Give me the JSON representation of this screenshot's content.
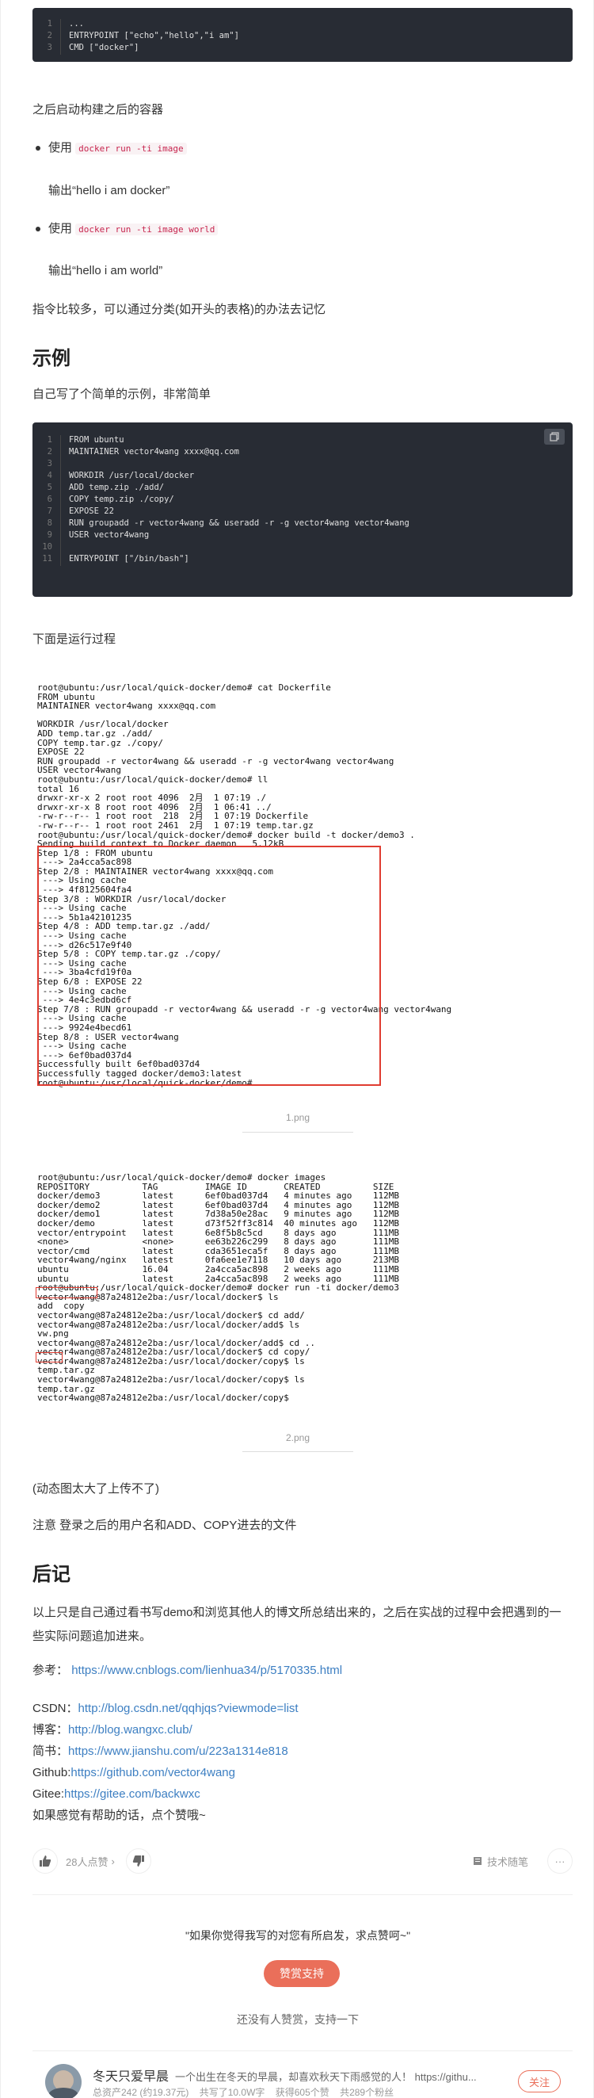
{
  "code_block_1": {
    "lines": [
      {
        "num": "1",
        "text": "..."
      },
      {
        "num": "2",
        "text": "ENTRYPOINT [\"echo\",\"hello\",\"i am\"]"
      },
      {
        "num": "3",
        "text": "CMD [\"docker\"]"
      }
    ]
  },
  "text_after_start": "之后启动构建之后的容器",
  "bullets": [
    {
      "prefix": "使用 ",
      "code": "docker run -ti image",
      "output": "输出“hello i am docker”"
    },
    {
      "prefix": "使用 ",
      "code": "docker run -ti image world",
      "output": "输出“hello i am world”"
    }
  ],
  "text_commands_many": "指令比较多，可以通过分类(如开头的表格)的办法去记忆",
  "heading_example": "示例",
  "text_example_intro": "自己写了个简单的示例，非常简单",
  "code_block_2": {
    "lines": [
      {
        "num": "1",
        "text": "FROM ubuntu"
      },
      {
        "num": "2",
        "text": "MAINTAINER vector4wang xxxx@qq.com"
      },
      {
        "num": "3",
        "text": ""
      },
      {
        "num": "4",
        "text": "WORKDIR /usr/local/docker"
      },
      {
        "num": "5",
        "text": "ADD temp.zip ./add/"
      },
      {
        "num": "6",
        "text": "COPY temp.zip ./copy/"
      },
      {
        "num": "7",
        "text": "EXPOSE 22"
      },
      {
        "num": "8",
        "text": "RUN groupadd -r vector4wang && useradd -r -g vector4wang vector4wang"
      },
      {
        "num": "9",
        "text": "USER vector4wang"
      },
      {
        "num": "10",
        "text": ""
      },
      {
        "num": "11",
        "text": "ENTRYPOINT [\"/bin/bash\"]"
      }
    ]
  },
  "text_run_process": "下面是运行过程",
  "terminal_1": [
    "root@ubuntu:/usr/local/quick-docker/demo# cat Dockerfile",
    "FROM ubuntu",
    "MAINTAINER vector4wang xxxx@qq.com",
    "",
    "WORKDIR /usr/local/docker",
    "ADD temp.tar.gz ./add/",
    "COPY temp.tar.gz ./copy/",
    "EXPOSE 22",
    "RUN groupadd -r vector4wang && useradd -r -g vector4wang vector4wang",
    "USER vector4wang",
    "root@ubuntu:/usr/local/quick-docker/demo# ll",
    "total 16",
    "drwxr-xr-x 2 root root 4096  2月  1 07:19 ./",
    "drwxr-xr-x 8 root root 4096  2月  1 06:41 ../",
    "-rw-r--r-- 1 root root  218  2月  1 07:19 Dockerfile",
    "-rw-r--r-- 1 root root 2461  2月  1 07:19 temp.tar.gz",
    "root@ubuntu:/usr/local/quick-docker/demo# docker build -t docker/demo3 .",
    "Sending build context to Docker daemon   5.12kB",
    "Step 1/8 : FROM ubuntu",
    " ---> 2a4cca5ac898",
    "Step 2/8 : MAINTAINER vector4wang xxxx@qq.com",
    " ---> Using cache",
    " ---> 4f8125604fa4",
    "Step 3/8 : WORKDIR /usr/local/docker",
    " ---> Using cache",
    " ---> 5b1a42101235",
    "Step 4/8 : ADD temp.tar.gz ./add/",
    " ---> Using cache",
    " ---> d26c517e9f40",
    "Step 5/8 : COPY temp.tar.gz ./copy/",
    " ---> Using cache",
    " ---> 3ba4cfd19f0a",
    "Step 6/8 : EXPOSE 22",
    " ---> Using cache",
    " ---> 4e4c3edbd6cf",
    "Step 7/8 : RUN groupadd -r vector4wang && useradd -r -g vector4wang vector4wang",
    " ---> Using cache",
    " ---> 9924e4becd61",
    "Step 8/8 : USER vector4wang",
    " ---> Using cache",
    " ---> 6ef0bad037d4",
    "Successfully built 6ef0bad037d4",
    "Successfully tagged docker/demo3:latest",
    "root@ubuntu:/usr/local/quick-docker/demo#"
  ],
  "caption_1": "1.png",
  "terminal_2": [
    "root@ubuntu:/usr/local/quick-docker/demo# docker images",
    "REPOSITORY          TAG         IMAGE ID       CREATED          SIZE",
    "docker/demo3        latest      6ef0bad037d4   4 minutes ago    112MB",
    "docker/demo2        latest      6ef0bad037d4   4 minutes ago    112MB",
    "docker/demo1        latest      7d38a50e28ac   9 minutes ago    112MB",
    "docker/demo         latest      d73f52ff3c814  40 minutes ago   112MB",
    "vector/entrypoint   latest      6e8f5b8c5cd    8 days ago       111MB",
    "<none>              <none>      ee63b226c299   8 days ago       111MB",
    "vector/cmd          latest      cda3651eca5f   8 days ago       111MB",
    "vector4wang/nginx   latest      0fa6ee1e7118   10 days ago      213MB",
    "ubuntu              16.04       2a4cca5ac898   2 weeks ago      111MB",
    "ubuntu              latest      2a4cca5ac898   2 weeks ago      111MB",
    "root@ubuntu:/usr/local/quick-docker/demo# docker run -ti docker/demo3",
    "vector4wang@87a24812e2ba:/usr/local/docker$ ls",
    "add  copy",
    "vector4wang@87a24812e2ba:/usr/local/docker$ cd add/",
    "vector4wang@87a24812e2ba:/usr/local/docker/add$ ls",
    "vw.png",
    "vector4wang@87a24812e2ba:/usr/local/docker/add$ cd ..",
    "vector4wang@87a24812e2ba:/usr/local/docker$ cd copy/",
    "vector4wang@87a24812e2ba:/usr/local/docker/copy$ ls",
    "temp.tar.gz",
    "vector4wang@87a24812e2ba:/usr/local/docker/copy$ ls",
    "temp.tar.gz",
    "vector4wang@87a24812e2ba:/usr/local/docker/copy$"
  ],
  "caption_2": "2.png",
  "text_gif_note": "(动态图太大了上传不了)",
  "text_notice": "注意 登录之后的用户名和ADD、COPY进去的文件",
  "heading_postscript": "后记",
  "text_summary": "以上只是自己通过看书写demo和浏览其他人的博文所总结出来的，之后在实战的过程中会把遇到的一些实际问题追加进来。",
  "reference": {
    "label": "参考：",
    "url": "https://www.cnblogs.com/lienhua34/p/5170335.html"
  },
  "profiles": [
    {
      "label": "CSDN：",
      "url": "http://blog.csdn.net/qqhjqs?viewmode=list"
    },
    {
      "label": "博客：",
      "url": "http://blog.wangxc.club/"
    },
    {
      "label": "简书：",
      "url": "https://www.jianshu.com/u/223a1314e818"
    },
    {
      "label": "Github:",
      "url": "https://github.com/vector4wang"
    },
    {
      "label": "Gitee:",
      "url": "https://gitee.com/backwxc"
    }
  ],
  "text_like_request": "如果感觉有帮助的话，点个赞哦~",
  "actions": {
    "likes": "28人点赞",
    "likes_chevron": "›",
    "category": "技术随笔",
    "more": "···"
  },
  "reward": {
    "quote": "\"如果你觉得我写的对您有所启发，求点赞呵~\"",
    "button": "赞赏支持",
    "note": "还没有人赞赏，支持一下"
  },
  "author": {
    "name": "冬天只爱早晨",
    "bio": "一个出生在冬天的早晨，却喜欢秋天下雨感觉的人！ https://githu...",
    "stats": "总资产242 (约19.37元)    共写了10.0W字    获得605个赞    共289个粉丝",
    "follow": "关注"
  },
  "colors": {
    "accent": "#ea6f5a",
    "link": "#3d7fc2",
    "code_bg": "#282c34",
    "annotation_red": "#e03c31"
  }
}
